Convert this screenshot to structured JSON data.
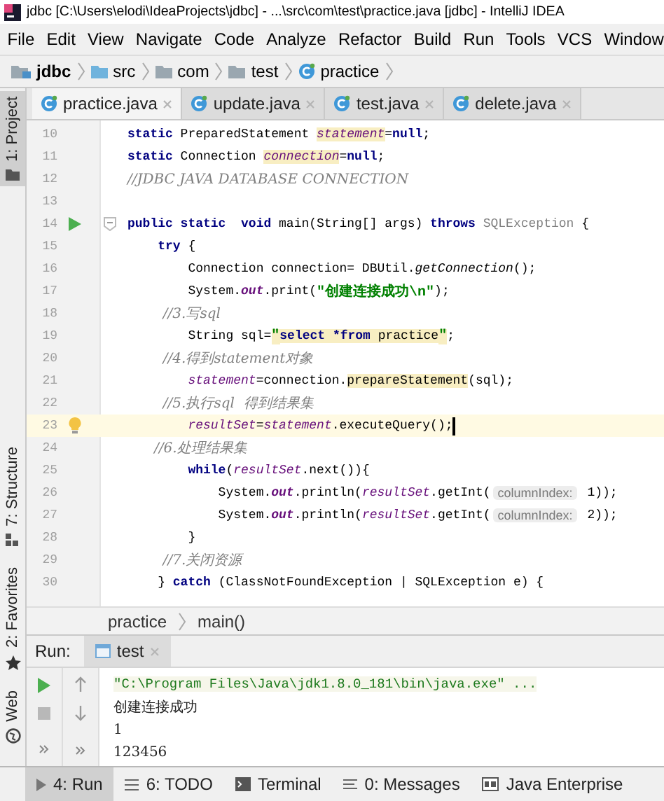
{
  "window": {
    "title": "jdbc [C:\\Users\\elodi\\IdeaProjects\\jdbc] - ...\\src\\com\\test\\practice.java [jdbc] - IntelliJ IDEA"
  },
  "menu": [
    "File",
    "Edit",
    "View",
    "Navigate",
    "Code",
    "Analyze",
    "Refactor",
    "Build",
    "Run",
    "Tools",
    "VCS",
    "Window"
  ],
  "navigation_bar": [
    {
      "label": "jdbc",
      "kind": "module"
    },
    {
      "label": "src",
      "kind": "source"
    },
    {
      "label": "com",
      "kind": "package"
    },
    {
      "label": "test",
      "kind": "package"
    },
    {
      "label": "practice",
      "kind": "class"
    }
  ],
  "left_tool_strip": {
    "top": [
      {
        "label": "1: Project",
        "selected": true
      }
    ],
    "bottom": [
      {
        "label": "7: Structure",
        "selected": false
      },
      {
        "label": "2: Favorites",
        "selected": false
      },
      {
        "label": "Web",
        "selected": false
      }
    ]
  },
  "editor_tabs": [
    {
      "label": "practice.java",
      "selected": true
    },
    {
      "label": "update.java",
      "selected": false
    },
    {
      "label": "test.java",
      "selected": false
    },
    {
      "label": "delete.java",
      "selected": false
    }
  ],
  "editor": {
    "lines": [
      {
        "number": "10",
        "tokens": [
          {
            "text": "static",
            "kind": "keyword"
          },
          {
            "text": " PreparedStatement ",
            "kind": "plain"
          },
          {
            "text": "statement",
            "kind": "field",
            "highlighted": true
          },
          {
            "text": "=",
            "kind": "plain"
          },
          {
            "text": "null",
            "kind": "keyword"
          },
          {
            "text": ";",
            "kind": "plain"
          }
        ]
      },
      {
        "number": "11",
        "tokens": [
          {
            "text": "static",
            "kind": "keyword"
          },
          {
            "text": " Connection ",
            "kind": "plain"
          },
          {
            "text": "connection",
            "kind": "field",
            "highlighted": true
          },
          {
            "text": "=",
            "kind": "plain"
          },
          {
            "text": "null",
            "kind": "keyword"
          },
          {
            "text": ";",
            "kind": "plain"
          }
        ]
      },
      {
        "number": "12",
        "tokens": [
          {
            "text": "//JDBC JAVA DATABASE CONNECTION",
            "kind": "comment"
          }
        ]
      },
      {
        "number": "13"
      },
      {
        "number": "14",
        "kind": "run",
        "tokens": [
          {
            "text": "public static  void",
            "kind": "keyword"
          },
          {
            "text": " main(String[] args) ",
            "kind": "plain"
          },
          {
            "text": "throws ",
            "kind": "keyword"
          },
          {
            "text": "SQLException",
            "kind": "unused"
          },
          {
            "text": " {",
            "kind": "plain"
          }
        ]
      },
      {
        "number": "15",
        "tokens": [
          {
            "text": "    try",
            "kind": "keyword"
          },
          {
            "text": " {",
            "kind": "plain"
          }
        ]
      },
      {
        "number": "16",
        "tokens": [
          {
            "text": "        Connection connection= DBUtil.",
            "kind": "plain"
          },
          {
            "text": "getConnection",
            "kind": "static_method"
          },
          {
            "text": "();",
            "kind": "plain"
          }
        ]
      },
      {
        "number": "17",
        "tokens": [
          {
            "text": "        System.",
            "kind": "plain"
          },
          {
            "text": "out",
            "kind": "static_field"
          },
          {
            "text": ".print(",
            "kind": "plain"
          },
          {
            "text": "\"创建连接成功\\n\"",
            "kind": "string"
          },
          {
            "text": ");",
            "kind": "plain"
          }
        ]
      },
      {
        "number": "18",
        "tokens": [
          {
            "text": "        //3.写sql",
            "kind": "comment"
          }
        ]
      },
      {
        "number": "19",
        "tokens": [
          {
            "text": "        String sql=",
            "kind": "plain"
          },
          {
            "text": "\"",
            "kind": "string",
            "highlighted": true
          },
          {
            "text": "select *from",
            "kind": "keyword",
            "highlighted": true
          },
          {
            "text": " practice",
            "kind": "plain",
            "highlighted": true
          },
          {
            "text": "\"",
            "kind": "string",
            "highlighted": true
          },
          {
            "text": ";",
            "kind": "plain"
          }
        ]
      },
      {
        "number": "20",
        "tokens": [
          {
            "text": "        //4.得到statement对象",
            "kind": "comment"
          }
        ]
      },
      {
        "number": "21",
        "tokens": [
          {
            "text": "        statement",
            "kind": "field"
          },
          {
            "text": "=connection.",
            "kind": "plain"
          },
          {
            "text": "prepareStatement",
            "kind": "plain",
            "highlighted": true
          },
          {
            "text": "(sql);",
            "kind": "plain"
          }
        ]
      },
      {
        "number": "22",
        "tokens": [
          {
            "text": "        //5.执行sql  得到结果集",
            "kind": "comment"
          }
        ]
      },
      {
        "number": "23",
        "kind": "intention",
        "current": true,
        "tokens": [
          {
            "text": "        resultSet",
            "kind": "field"
          },
          {
            "text": "=",
            "kind": "plain"
          },
          {
            "text": "statement",
            "kind": "field"
          },
          {
            "text": ".executeQuery();",
            "kind": "plain"
          }
        ]
      },
      {
        "number": "24",
        "tokens": [
          {
            "text": "      //6.处理结果集",
            "kind": "comment"
          }
        ]
      },
      {
        "number": "25",
        "tokens": [
          {
            "text": "        while",
            "kind": "keyword"
          },
          {
            "text": "(",
            "kind": "plain"
          },
          {
            "text": "resultSet",
            "kind": "field"
          },
          {
            "text": ".next()){",
            "kind": "plain"
          }
        ]
      },
      {
        "number": "26",
        "tokens": [
          {
            "text": "            System.",
            "kind": "plain"
          },
          {
            "text": "out",
            "kind": "static_field"
          },
          {
            "text": ".println(",
            "kind": "plain"
          },
          {
            "text": "resultSet",
            "kind": "field"
          },
          {
            "text": ".getInt(",
            "kind": "plain"
          },
          {
            "text": "columnIndex:",
            "kind": "hint"
          },
          {
            "text": " 1));",
            "kind": "plain"
          }
        ]
      },
      {
        "number": "27",
        "tokens": [
          {
            "text": "            System.",
            "kind": "plain"
          },
          {
            "text": "out",
            "kind": "static_field"
          },
          {
            "text": ".println(",
            "kind": "plain"
          },
          {
            "text": "resultSet",
            "kind": "field"
          },
          {
            "text": ".getInt(",
            "kind": "plain"
          },
          {
            "text": "columnIndex:",
            "kind": "hint"
          },
          {
            "text": " 2));",
            "kind": "plain"
          }
        ]
      },
      {
        "number": "28",
        "tokens": [
          {
            "text": "        }",
            "kind": "plain"
          }
        ]
      },
      {
        "number": "29",
        "tokens": [
          {
            "text": "        //7.关闭资源",
            "kind": "comment"
          }
        ]
      },
      {
        "number": "30",
        "tokens": [
          {
            "text": "    } ",
            "kind": "plain"
          },
          {
            "text": "catch",
            "kind": "keyword"
          },
          {
            "text": " (ClassNotFoundException | SQLException e) {",
            "kind": "plain"
          }
        ]
      }
    ]
  },
  "editor_breadcrumb": [
    "practice",
    "main()"
  ],
  "run_panel": {
    "label": "Run:",
    "tabs": [
      {
        "label": "test",
        "selected": true
      }
    ],
    "console": [
      {
        "text": "\"C:\\Program Files\\Java\\jdk1.8.0_181\\bin\\java.exe\" ...",
        "kind": "command"
      },
      {
        "text": "创建连接成功",
        "kind": "output"
      },
      {
        "text": "1",
        "kind": "output"
      },
      {
        "text": "123456",
        "kind": "output"
      }
    ]
  },
  "status_bar": [
    {
      "label": "4: Run",
      "selected": true
    },
    {
      "label": "6: TODO",
      "selected": false
    },
    {
      "label": "Terminal",
      "selected": false
    },
    {
      "label": "0: Messages",
      "selected": false
    },
    {
      "label": "Java Enterprise",
      "selected": false
    }
  ]
}
